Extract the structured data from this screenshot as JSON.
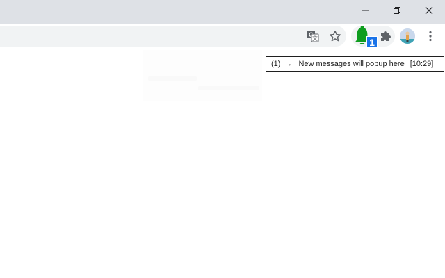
{
  "window": {
    "minimize_icon": "minimize-icon",
    "restore_icon": "restore-icon",
    "close_icon": "close-icon"
  },
  "toolbar": {
    "translate_icon": "translate-icon",
    "bookmark_icon": "star-icon",
    "notification_extension": {
      "icon": "bell-icon",
      "badge": "1",
      "color": "#0f9d1f"
    },
    "extensions_icon": "puzzle-icon",
    "menu_icon": "more-vert-icon"
  },
  "tooltip": {
    "count": "(1)",
    "arrow": "→",
    "message": "New messages will popup here",
    "time": "[10:29]"
  },
  "colors": {
    "titlebar": "#dee1e6",
    "omnibox": "#f1f3f4",
    "badge": "#1a73e8"
  }
}
